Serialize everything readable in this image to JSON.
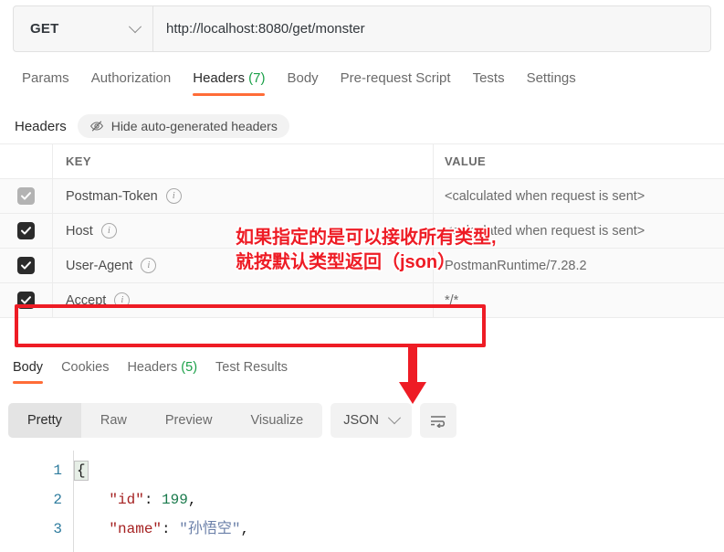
{
  "request": {
    "method": "GET",
    "url": "http://localhost:8080/get/monster",
    "tabs": [
      {
        "label": "Params",
        "active": false
      },
      {
        "label": "Authorization",
        "active": false
      },
      {
        "label": "Headers",
        "count": "(7)",
        "active": true
      },
      {
        "label": "Body",
        "active": false
      },
      {
        "label": "Pre-request Script",
        "active": false
      },
      {
        "label": "Tests",
        "active": false
      },
      {
        "label": "Settings",
        "active": false
      }
    ]
  },
  "headers_panel": {
    "title": "Headers",
    "hide_button_label": "Hide auto-generated headers",
    "columns": {
      "key": "KEY",
      "value": "VALUE"
    },
    "rows": [
      {
        "checked": true,
        "disabled": true,
        "key": "Postman-Token",
        "value": "<calculated when request is sent>"
      },
      {
        "checked": true,
        "disabled": false,
        "key": "Host",
        "value": "<calculated when request is sent>"
      },
      {
        "checked": true,
        "disabled": false,
        "key": "User-Agent",
        "value": "PostmanRuntime/7.28.2"
      },
      {
        "checked": true,
        "disabled": false,
        "key": "Accept",
        "value": "*/*"
      }
    ]
  },
  "response": {
    "tabs": [
      {
        "label": "Body",
        "active": true
      },
      {
        "label": "Cookies",
        "active": false
      },
      {
        "label": "Headers",
        "count": "(5)",
        "active": false
      },
      {
        "label": "Test Results",
        "active": false
      }
    ],
    "view_modes": [
      {
        "label": "Pretty",
        "active": true
      },
      {
        "label": "Raw",
        "active": false
      },
      {
        "label": "Preview",
        "active": false
      },
      {
        "label": "Visualize",
        "active": false
      }
    ],
    "format": "JSON",
    "body_lines": [
      {
        "n": "1",
        "brace": "{",
        "key": "",
        "sep": "",
        "num": "",
        "str": "",
        "tail": ""
      },
      {
        "n": "2",
        "brace": "",
        "key": "\"id\"",
        "sep": ": ",
        "num": "199",
        "str": "",
        "tail": ","
      },
      {
        "n": "3",
        "brace": "",
        "key": "\"name\"",
        "sep": ": ",
        "num": "",
        "str": "\"孙悟空\"",
        "tail": ","
      }
    ]
  },
  "annotations": {
    "note_line1": "如果指定的是可以接收所有类型,",
    "note_line2": "就按默认类型返回（json）",
    "accent_color": "#ee1c25"
  }
}
